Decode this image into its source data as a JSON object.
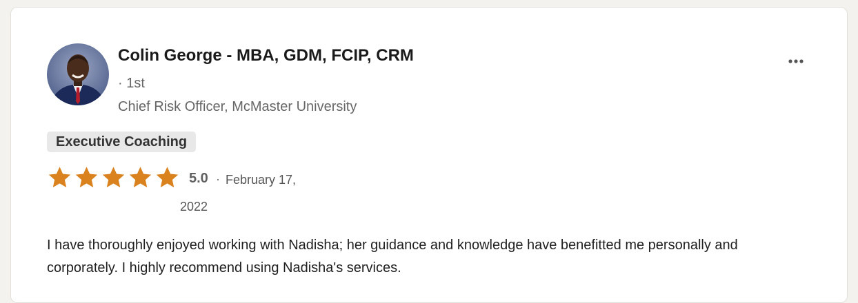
{
  "review": {
    "reviewer_name": "Colin George - MBA, GDM, FCIP, CRM",
    "connection_degree": "· 1st",
    "headline": "Chief Risk Officer, McMaster University",
    "service": "Executive Coaching",
    "rating": "5.0",
    "rating_separator": "·",
    "date_part1": "February 17,",
    "date_part2": "2022",
    "text": "I have thoroughly enjoyed working with Nadisha; her guidance and knowledge have benefitted me personally and corporately. I highly recommend using Nadisha's services.",
    "stars_filled": 5,
    "stars_total": 5
  },
  "icons": {
    "avatar": "avatar-photo",
    "more": "more-options-icon",
    "star": "star-icon"
  },
  "colors": {
    "star": "#d9821e",
    "tag_bg": "#e8e8e8",
    "card_bg": "#ffffff"
  }
}
